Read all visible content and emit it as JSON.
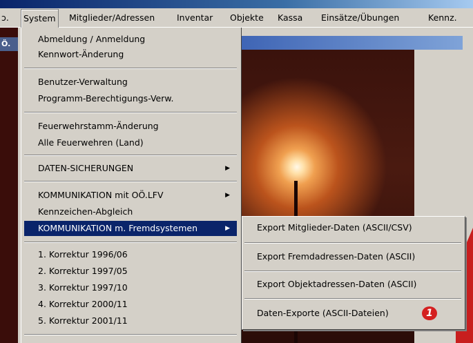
{
  "menubar": {
    "left_fragment": "ɔ.",
    "items": [
      "System",
      "Mitglieder/Adressen",
      "Inventar",
      "Objekte",
      "Kassa",
      "Einsätze/Übungen",
      "Kennz."
    ]
  },
  "left_caption": "Ö.",
  "system_menu": {
    "items": [
      "Abmeldung / Anmeldung",
      "Kennwort-Änderung",
      "Benutzer-Verwaltung",
      "Programm-Berechtigungs-Verw.",
      "Feuerwehrstamm-Änderung",
      "Alle Feuerwehren (Land)",
      "DATEN-SICHERUNGEN",
      "KOMMUNIKATION mit OÖ.LFV",
      "Kennzeichen-Abgleich",
      "KOMMUNIKATION m. Fremdsystemen",
      "1. Korrektur 1996/06",
      "2. Korrektur 1997/05",
      "3. Korrektur 1997/10",
      "4. Korrektur 2000/11",
      "5. Korrektur 2001/11"
    ],
    "submenu_arrow": "▶"
  },
  "export_submenu": {
    "items": [
      "Export Mitglieder-Daten (ASCII/CSV)",
      "Export Fremdadressen-Daten (ASCII)",
      "Export Objektadressen-Daten (ASCII)",
      "Daten-Exporte (ASCII-Dateien)"
    ],
    "badge": "1"
  },
  "colors": {
    "highlight": "#0a246a",
    "menu_bg": "#d4d0c8",
    "badge": "#d42020"
  }
}
